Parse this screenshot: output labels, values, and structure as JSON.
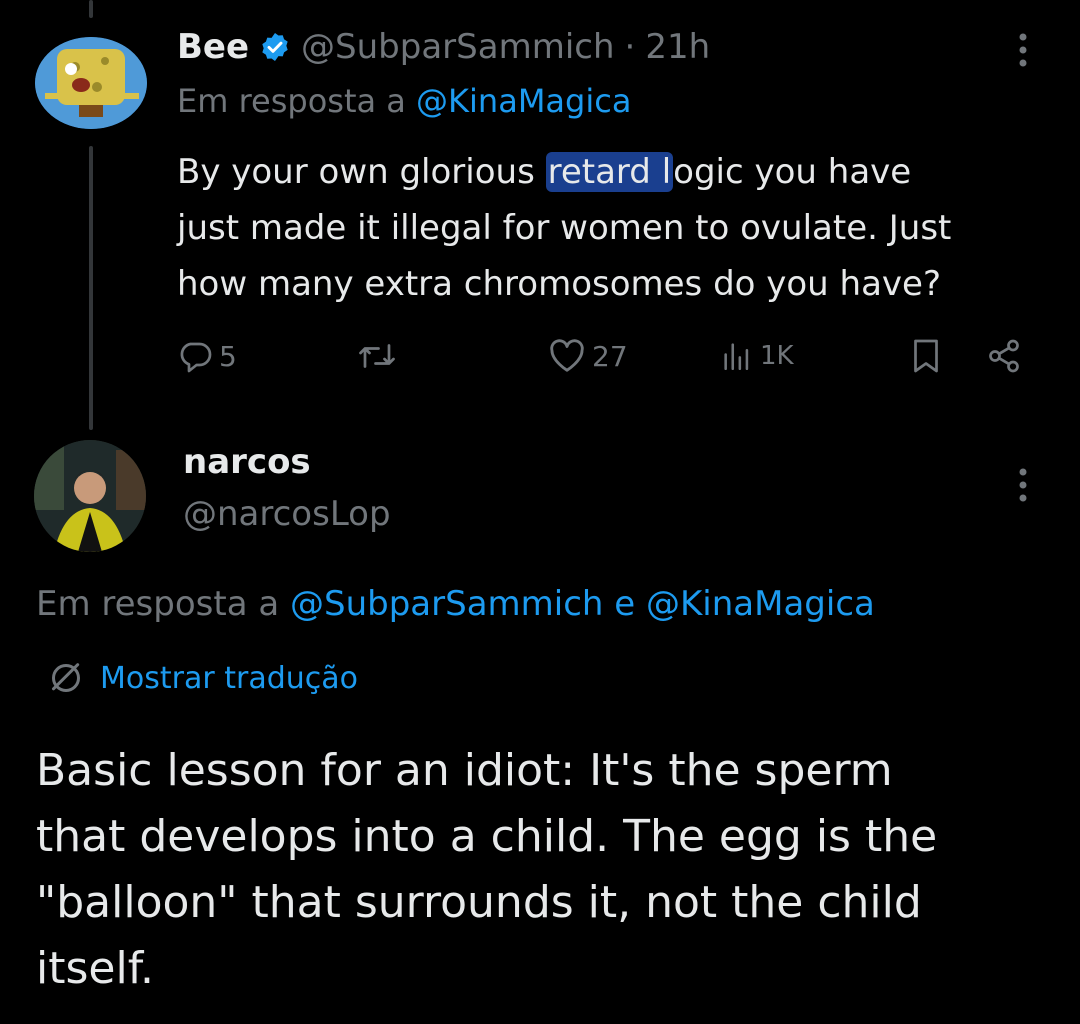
{
  "tweet1": {
    "display_name": "Bee",
    "handle": "@SubparSammich",
    "separator": "·",
    "time": "21h",
    "reply_prefix": "Em resposta a",
    "reply_to": "@KinaMagica",
    "text_before": "By your own glorious ",
    "text_highlight": "retard l",
    "text_line1_after": "ogic you have",
    "text_line2": "just made it illegal for women to ovulate. Just",
    "text_line3": "how many extra chromosomes do you have?",
    "reply_count": "5",
    "like_count": "27",
    "view_count": "1K"
  },
  "tweet2": {
    "display_name": "narcos",
    "handle": "@narcosLop",
    "reply_prefix": "Em resposta a",
    "reply_to_1": "@SubparSammich",
    "reply_joiner": "e",
    "reply_to_2": "@KinaMagica",
    "translate_label": "Mostrar tradução",
    "text_line1": "Basic lesson for an idiot: It's the sperm",
    "text_line2": "that develops into a child. The egg is the",
    "text_line3": "\"balloon\" that surrounds it, not the child",
    "text_line4": "itself."
  },
  "colors": {
    "background": "#000000",
    "text": "#e7e9ea",
    "muted": "#71767b",
    "link": "#1d9bf0",
    "verified": "#1d9bf0",
    "highlight": "#1a3f8f"
  },
  "icons": [
    "verified-badge-icon",
    "more-options-icon",
    "reply-icon",
    "retweet-icon",
    "like-icon",
    "views-icon",
    "bookmark-icon",
    "share-icon",
    "globe-translate-icon"
  ]
}
